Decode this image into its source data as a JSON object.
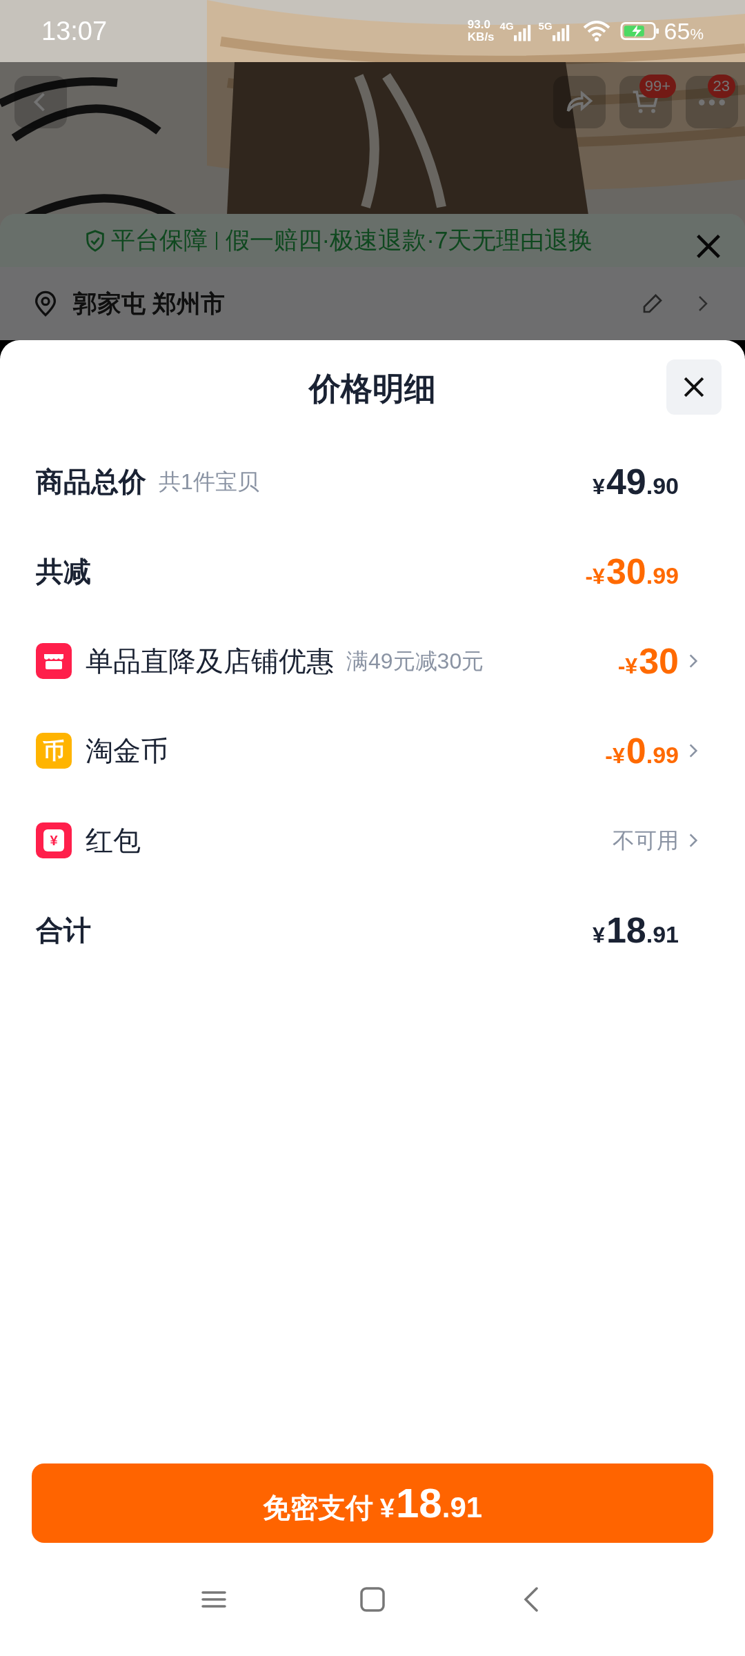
{
  "status_bar": {
    "time": "13:07",
    "speed": "93.0",
    "speed_unit": "KB/s",
    "network_1": "4G",
    "network_2": "5G",
    "battery": "65",
    "battery_unit": "%"
  },
  "header": {
    "cart_badge": "99+",
    "more_badge": "23"
  },
  "guarantee": {
    "title": "平台保障",
    "text": "假一赔四·极速退款·7天无理由退换"
  },
  "address": {
    "text": "郭家屯 郑州市"
  },
  "sheet": {
    "title": "价格明细"
  },
  "rows": [
    {
      "kind": "subtotal",
      "label": "商品总价",
      "note": "共1件宝贝",
      "price": {
        "sign": "¥",
        "int": "49",
        "dec": ".90"
      }
    },
    {
      "kind": "discount",
      "label": "共减",
      "price": {
        "sign": "-¥",
        "int": "30",
        "dec": ".99"
      }
    },
    {
      "kind": "shop",
      "label": "单品直降及店铺优惠",
      "note": "满49元减30元",
      "price": {
        "sign": "-¥",
        "int": "30"
      }
    },
    {
      "kind": "coin",
      "icon_text": "币",
      "label": "淘金币",
      "price": {
        "sign": "-¥",
        "int": "0",
        "dec": ".99"
      }
    },
    {
      "kind": "packet",
      "icon_text": "¥",
      "label": "红包",
      "status": "不可用"
    },
    {
      "kind": "total",
      "label": "合计",
      "price": {
        "sign": "¥",
        "int": "18",
        "dec": ".91"
      }
    }
  ],
  "pay_button": {
    "label": "免密支付",
    "price": {
      "sign": "¥",
      "int": "18",
      "dec": ".91"
    }
  }
}
